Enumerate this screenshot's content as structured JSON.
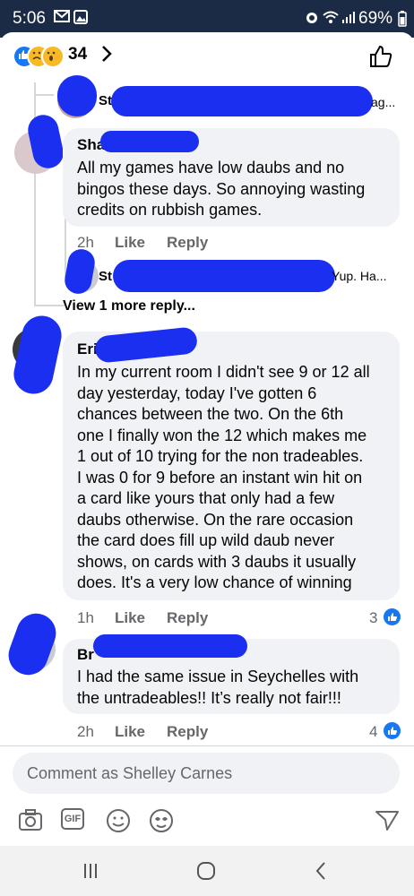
{
  "status_bar": {
    "time": "5:06",
    "battery": "69%"
  },
  "header": {
    "reaction_count": "34"
  },
  "comments": [
    {
      "name_visible": "St",
      "text_tail": "ag..."
    },
    {
      "name_visible": "Sha",
      "text": [
        "All my games have low daubs and no",
        "bingos these days. So annoying wasting",
        "credits on rubbish games."
      ],
      "time": "2h",
      "like": "Like",
      "reply": "Reply"
    },
    {
      "name_visible": "St",
      "text_tail": "Yup. Ha..."
    },
    {
      "view_more": "View 1 more reply..."
    },
    {
      "name_visible": "Eri",
      "text": [
        "In my current room I didn't see 9 or 12 all",
        "day yesterday, today I've gotten 6",
        "chances between the two.  On the 6th",
        "one I finally won the 12 which makes me",
        "1 out of 10 trying for the non tradeables.",
        "I was 0 for 9 before an instant win hit on",
        "a card like yours that only had a few",
        "daubs otherwise. On the rare occasion",
        "the card does fill up wild daub never",
        "shows, on cards with 3 daubs it usually",
        "does. It's a very low chance of winning"
      ],
      "time": "1h",
      "like": "Like",
      "reply": "Reply",
      "like_count": "3"
    },
    {
      "name_visible": "Br",
      "text": [
        "I had the same issue in Seychelles with",
        "the untradeables!! It’s really not fair!!!"
      ],
      "time": "2h",
      "like": "Like",
      "reply": "Reply",
      "like_count": "4"
    }
  ],
  "composer": {
    "placeholder": "Comment as Shelley Carnes",
    "gif_label": "GIF"
  },
  "colors": {
    "accent": "#1877f2",
    "scribble": "#1a2ff0",
    "status_bar": "#1c2b45",
    "bubble": "#f0f2f5"
  }
}
